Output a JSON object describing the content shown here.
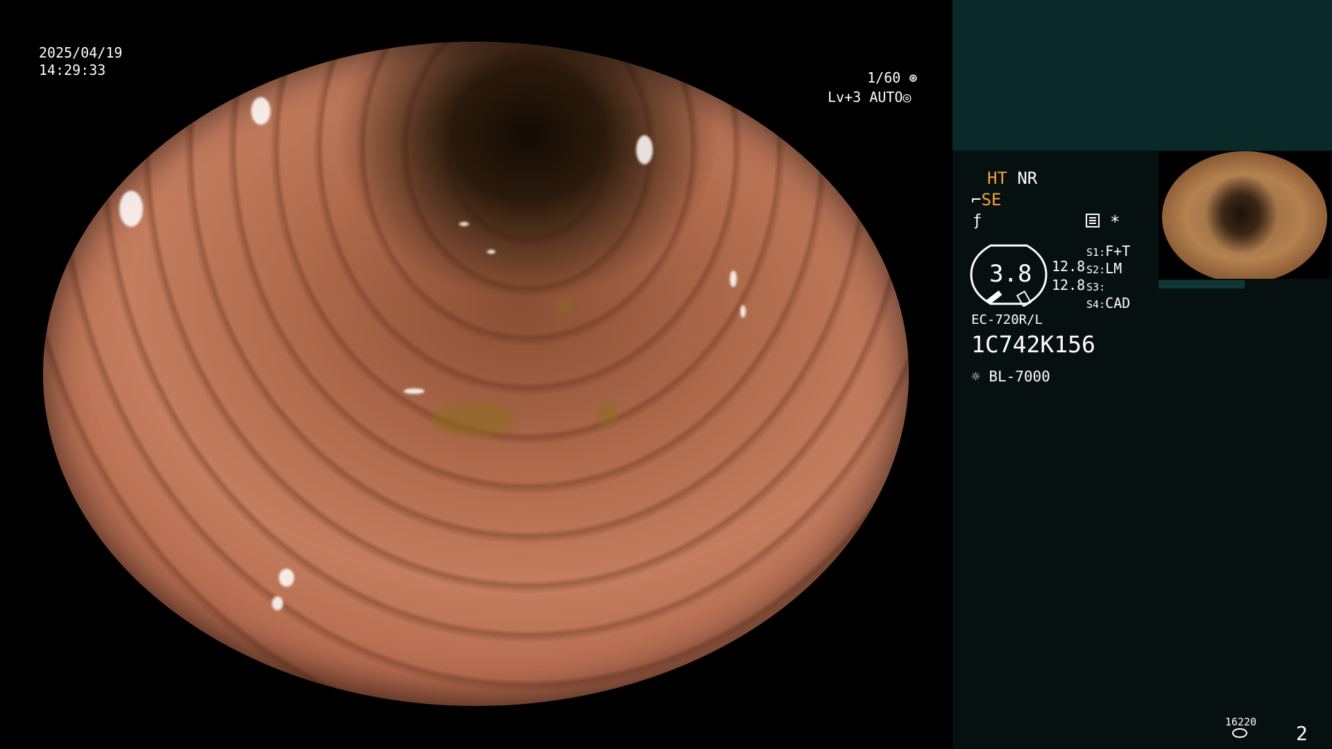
{
  "overlay": {
    "date": "2025/04/19",
    "time": "14:29:33",
    "shutter": "1/60",
    "shutter_icon": "aperture-icon",
    "level": "Lv+3",
    "mode": "AUTO",
    "mode_icon": "iris-icon"
  },
  "panel": {
    "mode_ht": "HT",
    "mode_nr": "NR",
    "mode_se": "SE",
    "settings_icon": "settings-list-icon",
    "asterisk": "*",
    "gauge_value": "3.8",
    "value_top": "12.8",
    "value_bottom": "12.8",
    "switches": [
      {
        "key": "S1",
        "value": "F+T"
      },
      {
        "key": "S2",
        "value": "LM"
      },
      {
        "key": "S3",
        "value": ""
      },
      {
        "key": "S4",
        "value": "CAD"
      }
    ],
    "scope_model": "EC-720R/L",
    "serial": "1C742K156",
    "light_source": "BL-7000",
    "light_icon": "sun-icon",
    "counter": "16220",
    "disk_icon": "disk-icon",
    "page_number": "2"
  },
  "colors": {
    "accent_orange": "#f2a23a",
    "panel_bg": "#061010",
    "panel_top_band": "#0a2a2a"
  }
}
